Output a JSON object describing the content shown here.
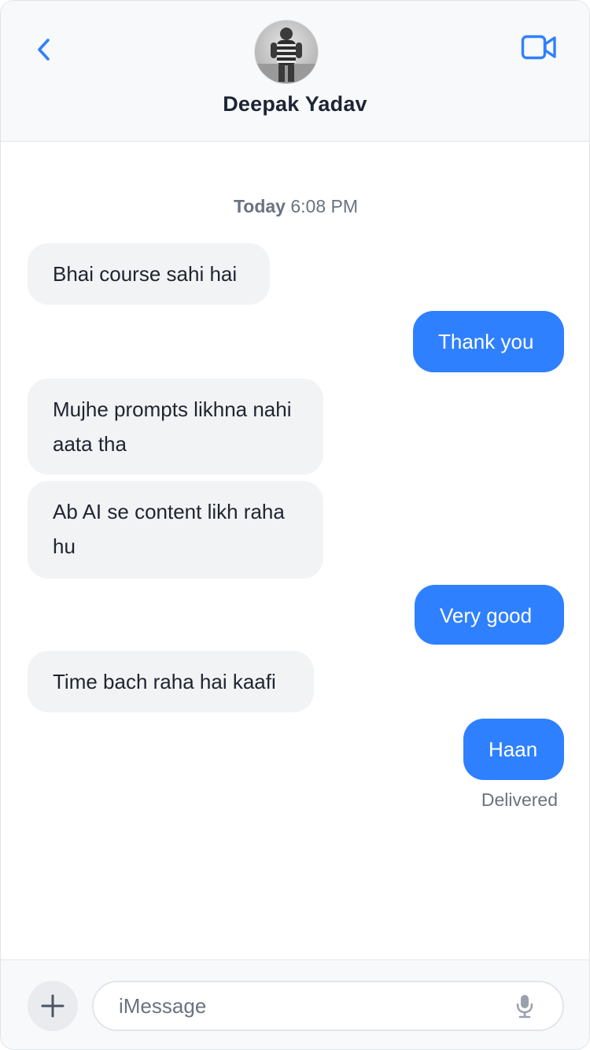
{
  "header": {
    "contact_name": "Deepak Yadav",
    "back_icon": "chevron-left-icon",
    "video_icon": "video-camera-icon",
    "accent_color": "#2f80ff"
  },
  "chat": {
    "timestamp_day": "Today",
    "timestamp_time": "6:08 PM",
    "messages": [
      {
        "from": "them",
        "text": "Bhai course sahi hai"
      },
      {
        "from": "me",
        "text": "Thank you"
      },
      {
        "from": "them",
        "text": "Mujhe prompts likhna nahi aata tha"
      },
      {
        "from": "them",
        "text": "Ab AI se content likh raha hu"
      },
      {
        "from": "me",
        "text": "Very good"
      },
      {
        "from": "them",
        "text": "Time bach raha hai kaafi"
      },
      {
        "from": "me",
        "text": "Haan"
      }
    ],
    "status": "Delivered",
    "outgoing_color": "#2f80ff",
    "incoming_color": "#f2f3f5"
  },
  "composer": {
    "placeholder": "iMessage",
    "value": "",
    "plus_icon": "plus-icon",
    "mic_icon": "microphone-icon"
  }
}
